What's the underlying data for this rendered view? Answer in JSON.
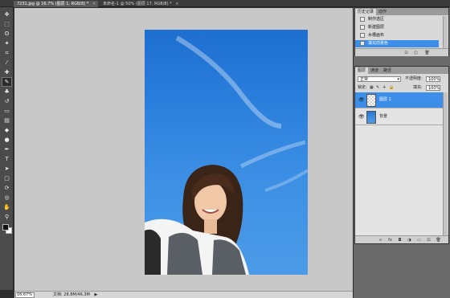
{
  "document_tabs": [
    {
      "title": "7231.jpg @ 16.7% (图层 1, RGB/8) *",
      "close": "×",
      "active": true
    },
    {
      "title": "未命名-1 @ 50% (图层 17, RGB/8) *",
      "close": "×",
      "active": false
    }
  ],
  "status": {
    "zoom": "16.67%",
    "doc_info": "文档: 28.8M/46.3M",
    "arrow": "▶"
  },
  "history_panel": {
    "tabs": [
      "历史记录",
      "动作"
    ],
    "items": [
      "制作选区",
      "新建图层",
      "水槽画布",
      "填充前景色"
    ],
    "selected_index": 3,
    "footer_icons": [
      "⊡",
      "◫",
      "🗑"
    ]
  },
  "layers_panel": {
    "tabs": [
      "图层",
      "通道",
      "路径"
    ],
    "blend_mode": "正常",
    "opacity_label": "不透明度:",
    "opacity_value": "100%",
    "lock_label": "锁定:",
    "lock_icons": [
      "▦",
      "✎",
      "✛",
      "🔒"
    ],
    "fill_label": "填充:",
    "fill_value": "100%",
    "layers": [
      {
        "name": "图层 1",
        "visible_icon": "👁",
        "selected": true
      },
      {
        "name": "背景",
        "visible_icon": "👁",
        "selected": false
      }
    ],
    "footer_icons": [
      "∞",
      "fx",
      "◘",
      "◑",
      "▭",
      "⊡",
      "🗑"
    ]
  },
  "tools": [
    {
      "name": "move-tool",
      "glyph": "✥"
    },
    {
      "name": "marquee-tool",
      "glyph": "⬚"
    },
    {
      "name": "lasso-tool",
      "glyph": "ʘ"
    },
    {
      "name": "quick-select-tool",
      "glyph": "✦"
    },
    {
      "name": "crop-tool",
      "glyph": "⌗"
    },
    {
      "name": "eyedropper-tool",
      "glyph": "⁄"
    },
    {
      "name": "healing-brush-tool",
      "glyph": "✚"
    },
    {
      "name": "brush-tool",
      "glyph": "✎"
    },
    {
      "name": "clone-stamp-tool",
      "glyph": "♣"
    },
    {
      "name": "history-brush-tool",
      "glyph": "↺"
    },
    {
      "name": "eraser-tool",
      "glyph": "▭"
    },
    {
      "name": "gradient-tool",
      "glyph": "▤"
    },
    {
      "name": "blur-tool",
      "glyph": "◆"
    },
    {
      "name": "dodge-tool",
      "glyph": "●"
    },
    {
      "name": "pen-tool",
      "glyph": "✒"
    },
    {
      "name": "type-tool",
      "glyph": "T"
    },
    {
      "name": "path-select-tool",
      "glyph": "➤"
    },
    {
      "name": "shape-tool",
      "glyph": "▢"
    },
    {
      "name": "3d-rotate-tool",
      "glyph": "⟳"
    },
    {
      "name": "3d-camera-tool",
      "glyph": "◎"
    },
    {
      "name": "hand-tool",
      "glyph": "✋"
    },
    {
      "name": "zoom-tool",
      "glyph": "⚲"
    }
  ],
  "colors": {
    "foreground": "#111111",
    "background": "#ffffff",
    "selection_blue": "#3c8ee8",
    "sky": "#2a7fdc"
  }
}
